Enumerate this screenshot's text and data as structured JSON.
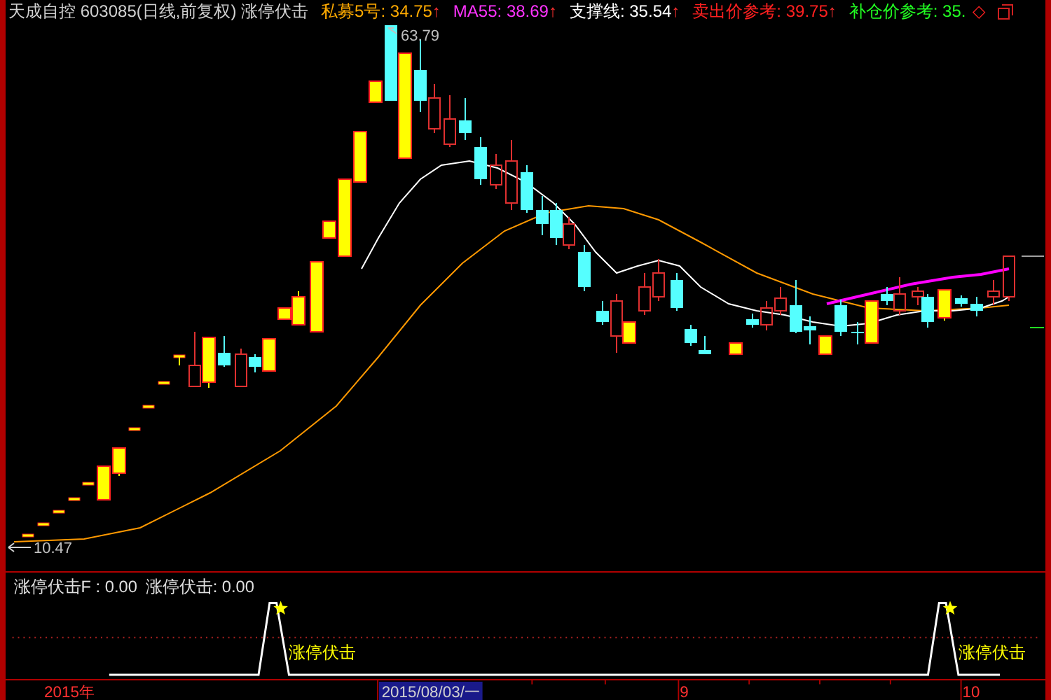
{
  "header": {
    "title": "天成自控 603085(日线,前复权) 涨停伏击",
    "indicators": [
      {
        "label": "私募5号: 34.75",
        "arrow": "↑",
        "color": "#ffaa00"
      },
      {
        "label": "MA55: 38.69",
        "arrow": "↑",
        "color": "#ff33ff"
      },
      {
        "label": "支撑线: 35.54",
        "arrow": "↑",
        "color": "#ffffff"
      },
      {
        "label": "卖出价参考: 39.75",
        "arrow": "↑",
        "color": "#ff2020"
      },
      {
        "label": "补仓价参考: 35.",
        "color": "#22ff22"
      }
    ],
    "marker": "◇"
  },
  "price_chart": {
    "high_label": "63.79",
    "low_label": "10.47"
  },
  "indicator_panel": {
    "readouts": [
      "涨停伏击F : 0.00",
      "涨停伏击: 0.00"
    ],
    "signals": [
      {
        "label": "涨停伏击"
      },
      {
        "label": "涨停伏击"
      }
    ]
  },
  "time_axis": [
    {
      "label": "2015年",
      "kind": "year"
    },
    {
      "label": "2015/08/03/一",
      "kind": "cursor"
    },
    {
      "label": "9",
      "kind": "month"
    },
    {
      "label": "10",
      "kind": "month"
    }
  ]
}
